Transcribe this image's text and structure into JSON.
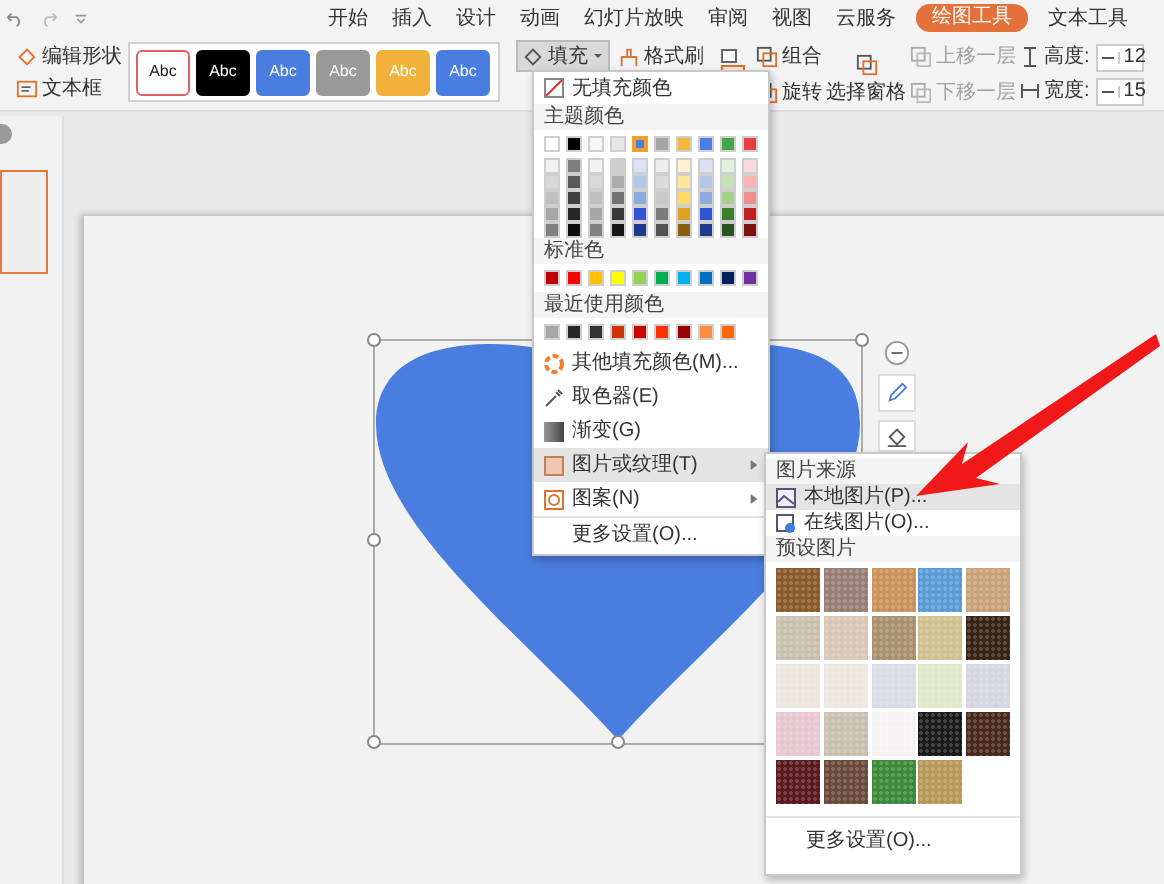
{
  "ribbon_tabs": [
    {
      "label": "开始",
      "selected": false
    },
    {
      "label": "插入",
      "selected": false
    },
    {
      "label": "设计",
      "selected": false
    },
    {
      "label": "动画",
      "selected": false
    },
    {
      "label": "幻灯片放映",
      "selected": false
    },
    {
      "label": "审阅",
      "selected": false
    },
    {
      "label": "视图",
      "selected": false
    },
    {
      "label": "云服务",
      "selected": false
    },
    {
      "label": "绘图工具",
      "selected": true
    },
    {
      "label": "文本工具",
      "selected": false
    }
  ],
  "ribbon": {
    "left_buttons": [
      {
        "label": "编辑形状"
      },
      {
        "label": "文本框"
      }
    ],
    "style_gallery": [
      {
        "label": "Abc",
        "color": "#ffffff"
      },
      {
        "label": "Abc",
        "color": "#000000"
      },
      {
        "label": "Abc",
        "color": "#4a7de0"
      },
      {
        "label": "Abc",
        "color": "#999999"
      },
      {
        "label": "Abc",
        "color": "#f2b13a"
      },
      {
        "label": "Abc",
        "color": "#4a7de0"
      }
    ],
    "fill_button": {
      "label": "填充",
      "pressed": true
    },
    "format_painter": {
      "label": "格式刷"
    },
    "arrange_buttons": [
      {
        "label": "组合",
        "disabled": false
      },
      {
        "label": "旋转",
        "disabled": false
      },
      {
        "label": "选择窗格",
        "disabled": false
      },
      {
        "label": "上移一层",
        "disabled": true
      },
      {
        "label": "下移一层",
        "disabled": true
      }
    ],
    "size_fields": [
      {
        "label": "高度:",
        "value": "12"
      },
      {
        "label": "宽度:",
        "value": "15"
      }
    ]
  },
  "fill_menu": {
    "no_fill": "无填充颜色",
    "theme_heading": "主题颜色",
    "theme_colors": [
      {
        "color": "#ffffff",
        "selected": false
      },
      {
        "color": "#000000",
        "selected": false
      },
      {
        "color": "#f7f7f7",
        "selected": false
      },
      {
        "color": "#e7e6e6",
        "selected": false
      },
      {
        "color": "#4a7de0",
        "selected": true
      },
      {
        "color": "#a5a5a5",
        "selected": false
      },
      {
        "color": "#f4b942",
        "selected": false
      },
      {
        "color": "#4a7de0",
        "selected": false
      },
      {
        "color": "#4aa54a",
        "selected": false
      },
      {
        "color": "#e84040",
        "selected": false
      }
    ],
    "theme_shades": [
      [
        {
          "color": "#f2f2f2"
        },
        {
          "color": "#7f7f7f"
        },
        {
          "color": "#f2f2f2"
        },
        {
          "color": "#d0cece"
        },
        {
          "color": "#dae3f3"
        },
        {
          "color": "#ededed"
        },
        {
          "color": "#fff2cc"
        },
        {
          "color": "#dae3f3"
        },
        {
          "color": "#e2efda"
        },
        {
          "color": "#fbdada"
        }
      ],
      [
        {
          "color": "#d9d9d9"
        },
        {
          "color": "#595959"
        },
        {
          "color": "#d9d9d9"
        },
        {
          "color": "#aeabab"
        },
        {
          "color": "#b4c7e7"
        },
        {
          "color": "#dbdbdb"
        },
        {
          "color": "#ffe699"
        },
        {
          "color": "#b4c7e7"
        },
        {
          "color": "#c5e0b4"
        },
        {
          "color": "#f6b4b4"
        }
      ],
      [
        {
          "color": "#bfbfbf"
        },
        {
          "color": "#404040"
        },
        {
          "color": "#bfbfbf"
        },
        {
          "color": "#757171"
        },
        {
          "color": "#8faadc"
        },
        {
          "color": "#c9c9c9"
        },
        {
          "color": "#ffd966"
        },
        {
          "color": "#8faadc"
        },
        {
          "color": "#a9d18e"
        },
        {
          "color": "#f08c8c"
        }
      ],
      [
        {
          "color": "#a6a6a6"
        },
        {
          "color": "#262626"
        },
        {
          "color": "#a6a6a6"
        },
        {
          "color": "#3a3838"
        },
        {
          "color": "#2f55d4"
        },
        {
          "color": "#7b7b7b"
        },
        {
          "color": "#e0a020"
        },
        {
          "color": "#2f55d4"
        },
        {
          "color": "#3b7d2a"
        },
        {
          "color": "#c02020"
        }
      ],
      [
        {
          "color": "#808080"
        },
        {
          "color": "#0d0d0d"
        },
        {
          "color": "#808080"
        },
        {
          "color": "#171616"
        },
        {
          "color": "#1f3a8a"
        },
        {
          "color": "#525252"
        },
        {
          "color": "#8a6010"
        },
        {
          "color": "#1f3a8a"
        },
        {
          "color": "#275420"
        },
        {
          "color": "#801010"
        }
      ]
    ],
    "standard_heading": "标准色",
    "standard_colors": [
      {
        "color": "#c00000"
      },
      {
        "color": "#ff0000"
      },
      {
        "color": "#ffc000"
      },
      {
        "color": "#ffff00"
      },
      {
        "color": "#92d050"
      },
      {
        "color": "#00b050"
      },
      {
        "color": "#00b0f0"
      },
      {
        "color": "#0070c0"
      },
      {
        "color": "#002060"
      },
      {
        "color": "#7030a0"
      }
    ],
    "recent_heading": "最近使用颜色",
    "recent_colors": [
      {
        "color": "#a6a6a6"
      },
      {
        "color": "#262626"
      },
      {
        "color": "#333333"
      },
      {
        "color": "#cc3300"
      },
      {
        "color": "#cc0000"
      },
      {
        "color": "#ff3300"
      },
      {
        "color": "#990000"
      },
      {
        "color": "#ff8c40"
      },
      {
        "color": "#ff6600"
      }
    ],
    "items": [
      {
        "label": "其他填充颜色(M)...",
        "submenu": false,
        "selected": false
      },
      {
        "label": "取色器(E)",
        "submenu": false,
        "selected": false
      },
      {
        "label": "渐变(G)",
        "submenu": false,
        "selected": false
      },
      {
        "label": "图片或纹理(T)",
        "submenu": true,
        "selected": true
      },
      {
        "label": "图案(N)",
        "submenu": true,
        "selected": false
      },
      {
        "label": "更多设置(O)...",
        "submenu": false,
        "selected": false
      }
    ]
  },
  "texture_menu": {
    "source_heading": "图片来源",
    "sources": [
      {
        "label": "本地图片(P)...",
        "selected": true
      },
      {
        "label": "在线图片(O)...",
        "selected": false
      }
    ],
    "preset_heading": "预设图片",
    "textures": [
      {
        "color": "#8b5a2b"
      },
      {
        "color": "#9a7f78"
      },
      {
        "color": "#c8935a"
      },
      {
        "color": "#5b9bd5"
      },
      {
        "color": "#c8a27a"
      },
      {
        "color": "#c9bfae"
      },
      {
        "color": "#d8c8b8"
      },
      {
        "color": "#a89070"
      },
      {
        "color": "#d0c090"
      },
      {
        "color": "#3a2418"
      },
      {
        "color": "#ece6dc"
      },
      {
        "color": "#eee6e0"
      },
      {
        "color": "#d8dce6"
      },
      {
        "color": "#dfe8c8"
      },
      {
        "color": "#d4d6e0"
      },
      {
        "color": "#e8c8d0"
      },
      {
        "color": "#c8c0b0"
      },
      {
        "color": "#f4f2f2"
      },
      {
        "color": "#1a1a1a"
      },
      {
        "color": "#4a2a20"
      },
      {
        "color": "#5a1a20"
      },
      {
        "color": "#6a4a3a"
      },
      {
        "color": "#3a8a3a"
      },
      {
        "color": "#b8985a"
      }
    ],
    "more": "更多设置(O)..."
  }
}
